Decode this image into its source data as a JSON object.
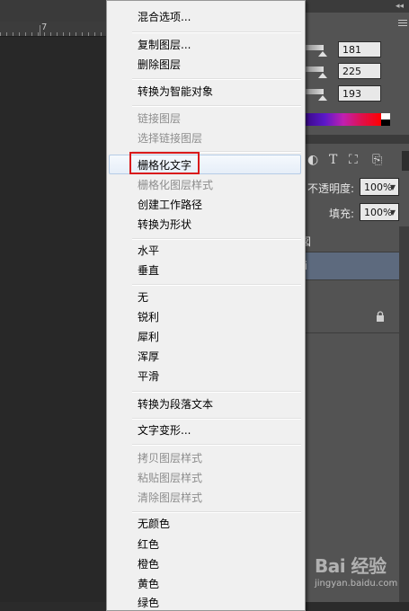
{
  "ruler": {
    "label": "7"
  },
  "color_panel": {
    "r": "181",
    "g": "225",
    "b": "193"
  },
  "layers_panel": {
    "opacity_label": "不透明度:",
    "opacity_value": "100%",
    "fill_label": "填充:",
    "fill_value": "100%",
    "layer_glyph_1": "図",
    "layer_glyph_2": "ti"
  },
  "context_menu": {
    "items": [
      {
        "label": "混合选项...",
        "enabled": true
      },
      {
        "label": "复制图层...",
        "enabled": true
      },
      {
        "label": "删除图层",
        "enabled": true
      },
      {
        "label": "转换为智能对象",
        "enabled": true
      },
      {
        "label": "链接图层",
        "enabled": false
      },
      {
        "label": "选择链接图层",
        "enabled": false
      },
      {
        "label": "栅格化文字",
        "enabled": true,
        "highlighted": true
      },
      {
        "label": "栅格化图层样式",
        "enabled": false
      },
      {
        "label": "创建工作路径",
        "enabled": true
      },
      {
        "label": "转换为形状",
        "enabled": true
      },
      {
        "label": "水平",
        "enabled": true
      },
      {
        "label": "垂直",
        "enabled": true
      },
      {
        "label": "无",
        "enabled": true
      },
      {
        "label": "锐利",
        "enabled": true
      },
      {
        "label": "犀利",
        "enabled": true
      },
      {
        "label": "浑厚",
        "enabled": true
      },
      {
        "label": "平滑",
        "enabled": true
      },
      {
        "label": "转换为段落文本",
        "enabled": true
      },
      {
        "label": "文字变形...",
        "enabled": true
      },
      {
        "label": "拷贝图层样式",
        "enabled": false
      },
      {
        "label": "粘贴图层样式",
        "enabled": false
      },
      {
        "label": "清除图层样式",
        "enabled": false
      },
      {
        "label": "无颜色",
        "enabled": true
      },
      {
        "label": "红色",
        "enabled": true
      },
      {
        "label": "橙色",
        "enabled": true
      },
      {
        "label": "黄色",
        "enabled": true
      },
      {
        "label": "绿色",
        "enabled": true
      }
    ]
  },
  "watermark": {
    "brand": "Bai 经验",
    "url": "jingyan.baidu.com"
  },
  "colors": {
    "highlight_border": "#d9191b",
    "menu_bg": "#f0f0f0",
    "panel_bg": "#535353",
    "selected_layer": "#5d6a7e"
  },
  "icons": [
    "ellipse-tool-icon",
    "type-tool-icon",
    "transform-icon",
    "document-icon",
    "lock-icon"
  ]
}
